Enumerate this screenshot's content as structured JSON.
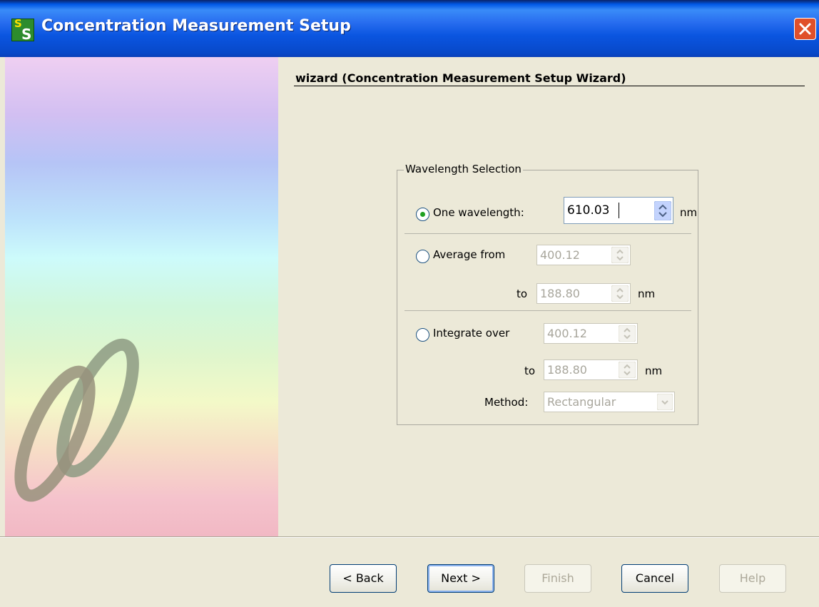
{
  "window": {
    "title": "Concentration Measurement Setup",
    "icon": "ss-app-icon",
    "close_icon": "close-icon"
  },
  "wizard": {
    "heading": "wizard (Concentration Measurement Setup Wizard)"
  },
  "wavelength": {
    "group_label": "Wavelength Selection",
    "one": {
      "label": "One wavelength:",
      "value": "610.03",
      "unit": "nm",
      "selected": true
    },
    "average": {
      "label": "Average from",
      "from": "400.12",
      "to_label": "to",
      "to": "188.80",
      "unit": "nm",
      "selected": false
    },
    "integrate": {
      "label": "Integrate over",
      "from": "400.12",
      "to_label": "to",
      "to": "188.80",
      "unit": "nm",
      "method_label": "Method:",
      "method": "Rectangular",
      "selected": false
    }
  },
  "buttons": {
    "back": "< Back",
    "next": "Next >",
    "finish": "Finish",
    "cancel": "Cancel",
    "help": "Help"
  },
  "colors": {
    "titlebar": "#0a55e0",
    "background": "#ece9d8",
    "radio_checked": "#21a121"
  }
}
